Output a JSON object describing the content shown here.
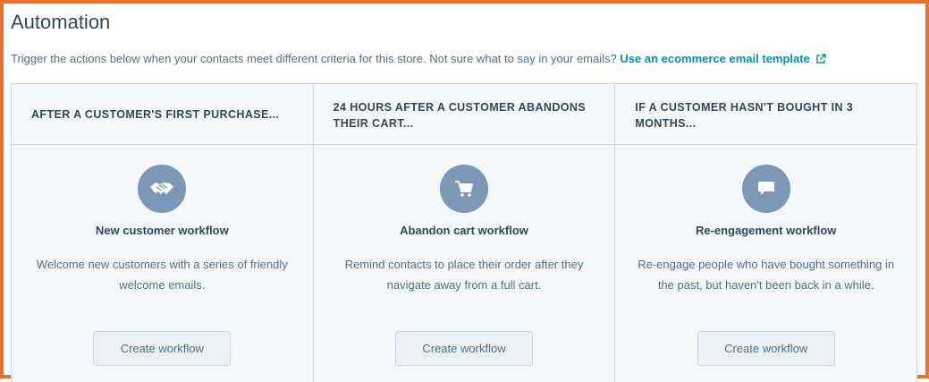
{
  "page": {
    "title": "Automation",
    "description": "Trigger the actions below when your contacts meet different criteria for this store. Not sure what to say in your emails?",
    "template_link": "Use an ecommerce email template"
  },
  "columns": [
    {
      "header": "AFTER A CUSTOMER'S FIRST PURCHASE...",
      "icon": "handshake-icon",
      "title": "New customer workflow",
      "description": "Welcome new customers with a series of friendly welcome emails.",
      "button": "Create workflow"
    },
    {
      "header": "24 HOURS AFTER A CUSTOMER ABANDONS THEIR CART...",
      "icon": "cart-icon",
      "title": "Abandon cart workflow",
      "description": "Remind contacts to place their order after they navigate away from a full cart.",
      "button": "Create workflow"
    },
    {
      "header": "IF A CUSTOMER HASN'T BOUGHT IN 3 MONTHS...",
      "icon": "speech-bubble-icon",
      "title": "Re-engagement workflow",
      "description": "Re-engage people who have bought something in the past, but haven't been back in a while.",
      "button": "Create workflow"
    }
  ],
  "colors": {
    "frame_border": "#e8722b",
    "link": "#0091ae",
    "icon_circle": "#7c98b6",
    "panel_bg": "#f5f8fa"
  }
}
